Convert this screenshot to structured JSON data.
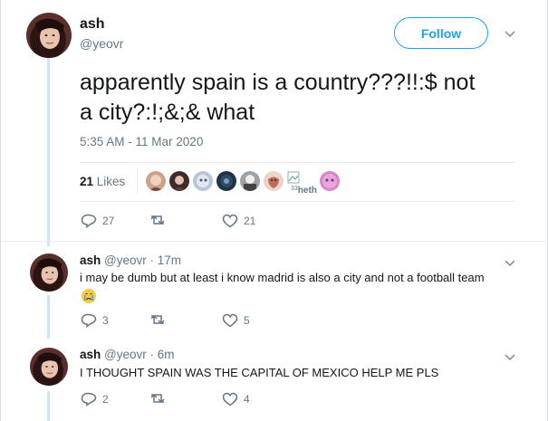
{
  "main_tweet": {
    "name": "ash",
    "handle": "@yeovr",
    "follow_label": "Follow",
    "text_line1": "apparently spain is a country???!!:$ not",
    "text_line2": "a city?:!;&;& what",
    "timestamp": "5:35 AM - 11 Mar 2020",
    "likes_count": "21",
    "likes_label": "Likes",
    "liker_alt_text": "heth",
    "actions": {
      "reply_count": "27",
      "like_count": "21"
    }
  },
  "replies": [
    {
      "name": "ash",
      "handle": "@yeovr",
      "time": "17m",
      "text": "i may be dumb but at least i know madrid is also a city and not a football team",
      "emoji": "crying-face",
      "reply_count": "3",
      "like_count": "5"
    },
    {
      "name": "ash",
      "handle": "@yeovr",
      "time": "6m",
      "text": "I THOUGHT SPAIN WAS THE CAPITAL OF MEXICO HELP ME PLS",
      "reply_count": "2",
      "like_count": "4"
    }
  ],
  "colors": {
    "accent": "#1da1f2",
    "muted": "#657786",
    "thread": "#cfe6f8"
  }
}
